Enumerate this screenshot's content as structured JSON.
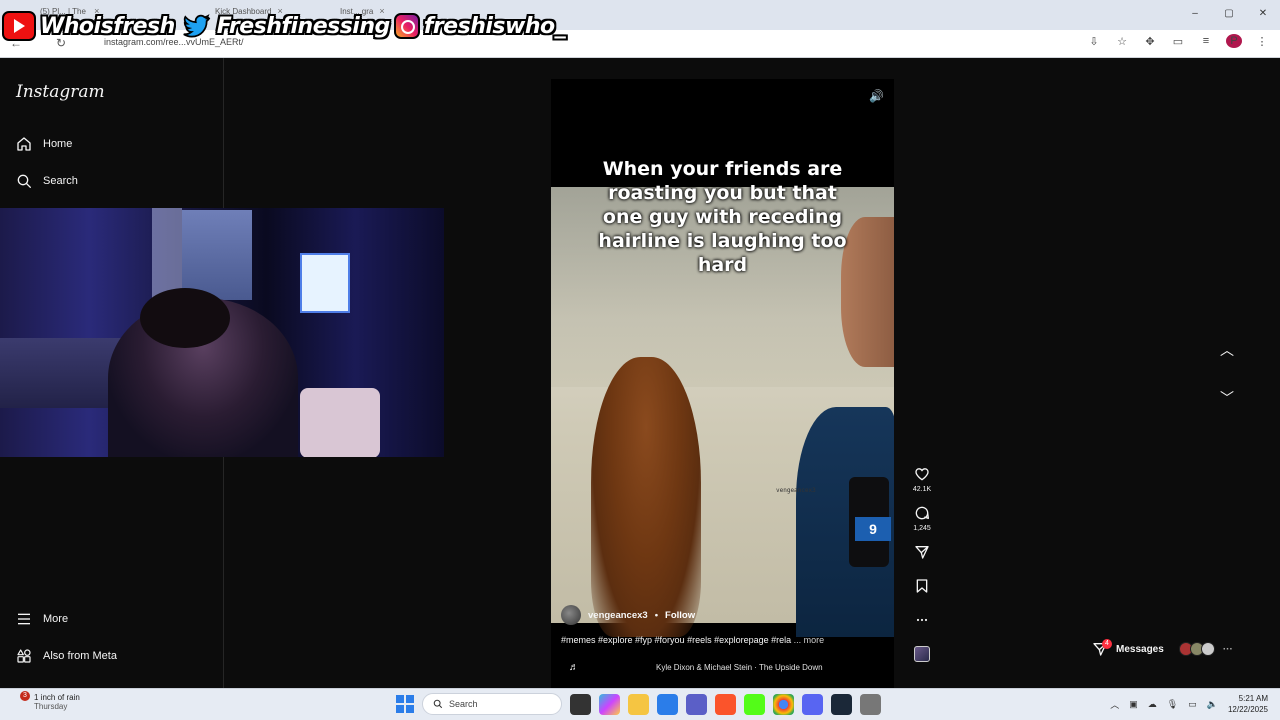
{
  "browser": {
    "tabs": [
      {
        "label": "(5) Pl... | The ",
        "close": "×"
      },
      {
        "label": "Kick Dashboard",
        "close": "×"
      },
      {
        "label": "Inst... gra",
        "close": "×"
      }
    ],
    "url": "instagram.com/ree...vvUmE_AERt/",
    "window_controls": [
      "–",
      "▢",
      "✕"
    ],
    "profile_initial": "P"
  },
  "overlay": {
    "youtube_handle": "Whoisfresh",
    "twitter_handle": "Freshfinessing",
    "instagram_handle": "freshiswho_"
  },
  "sidebar": {
    "logo": "Instagram",
    "items": [
      {
        "label": "Home"
      },
      {
        "label": "Search"
      },
      {
        "label": "More"
      },
      {
        "label": "Also from Meta"
      }
    ]
  },
  "reel": {
    "caption": "When your friends are roasting you but that one guy with receding hairline is laughing too hard",
    "watermark": "vengeancex3",
    "channel_logo": "9",
    "username": "vengeancex3",
    "separator": "•",
    "follow_label": "Follow",
    "hashtags": "#memes #explore #fyp #foryou #reels #explorepage #rela",
    "more_label": "... more",
    "audio": "Kyle Dixon & Michael Stein · The Upside Down",
    "likes": "42.1K",
    "comments": "1,245"
  },
  "messages": {
    "label": "Messages",
    "badge": "4"
  },
  "taskbar": {
    "weather_badge": "3",
    "weather": "1 inch of rain",
    "weather_day": "Thursday",
    "search_placeholder": "Search",
    "time": "5:21 AM",
    "date": "12/22/2025"
  },
  "colors": {
    "instagram_bg": "#0c0c0c",
    "accent_blue": "#2b7de9",
    "notification_red": "#ff3040"
  }
}
